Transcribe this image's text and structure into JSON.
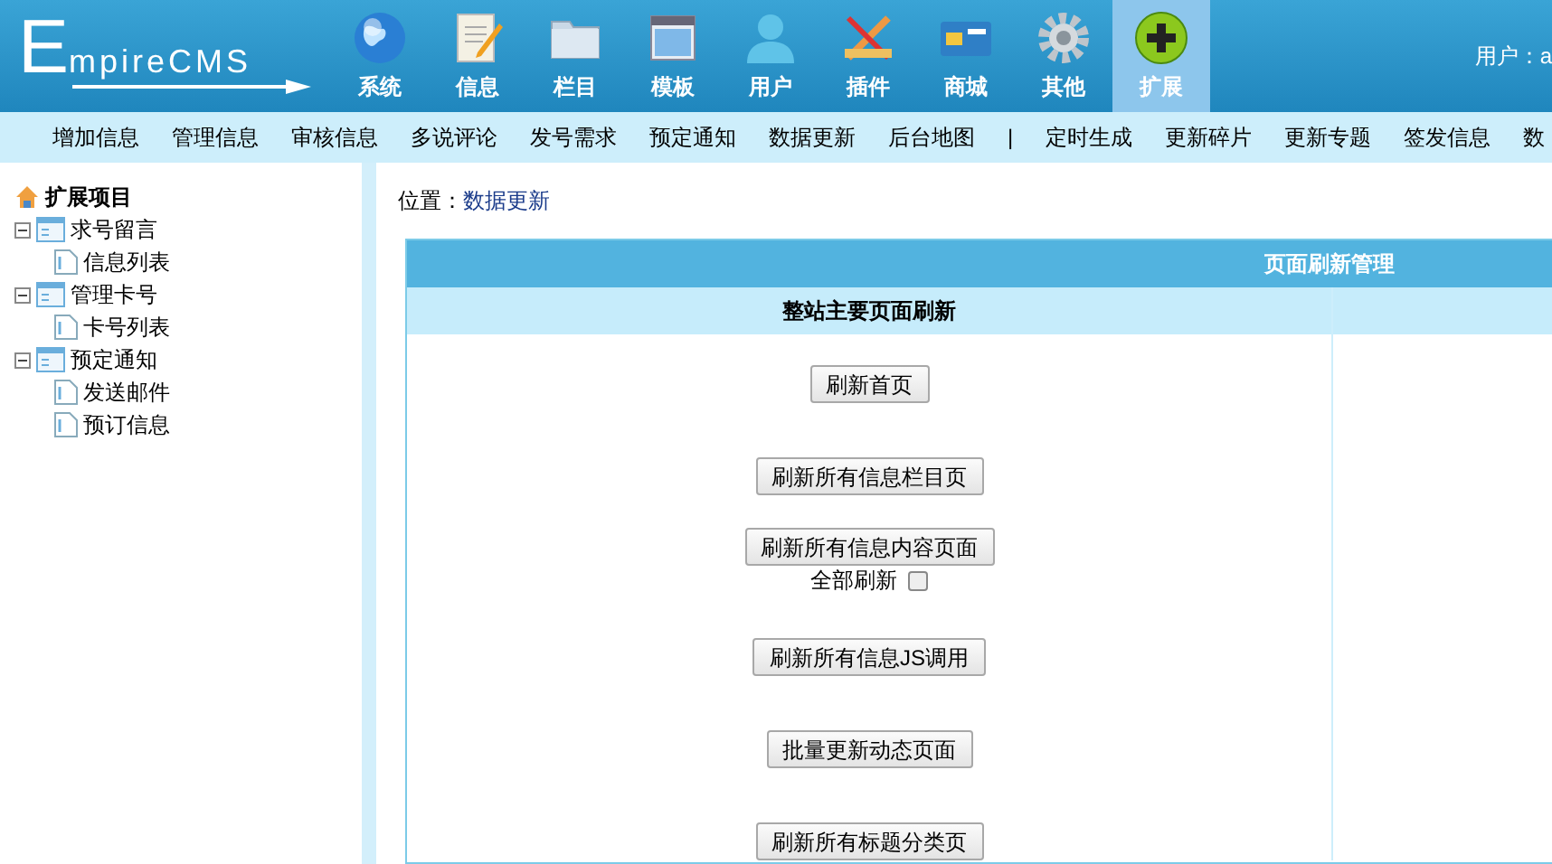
{
  "logo": "EmpireCMS",
  "nav": [
    {
      "label": "系统",
      "kind": "globe",
      "selected": false
    },
    {
      "label": "信息",
      "kind": "notepad",
      "selected": false
    },
    {
      "label": "栏目",
      "kind": "folder",
      "selected": false
    },
    {
      "label": "模板",
      "kind": "window",
      "selected": false
    },
    {
      "label": "用户",
      "kind": "user",
      "selected": false
    },
    {
      "label": "插件",
      "kind": "tools",
      "selected": false
    },
    {
      "label": "商城",
      "kind": "card",
      "selected": false
    },
    {
      "label": "其他",
      "kind": "gear",
      "selected": false
    },
    {
      "label": "扩展",
      "kind": "plus",
      "selected": true
    }
  ],
  "user_label": "用户：a",
  "subnav": [
    "增加信息",
    "管理信息",
    "审核信息",
    "多说评论",
    "发号需求",
    "预定通知",
    "数据更新",
    "后台地图",
    "|",
    "定时生成",
    "更新碎片",
    "更新专题",
    "签发信息",
    "数"
  ],
  "tree": {
    "title": "扩展项目",
    "children": [
      {
        "label": "求号留言",
        "children": [
          {
            "label": "信息列表"
          }
        ]
      },
      {
        "label": "管理卡号",
        "children": [
          {
            "label": "卡号列表"
          }
        ]
      },
      {
        "label": "预定通知",
        "children": [
          {
            "label": "发送邮件"
          },
          {
            "label": "预订信息"
          }
        ]
      }
    ]
  },
  "location": {
    "label": "位置：",
    "link": "数据更新"
  },
  "panel": {
    "title": "页面刷新管理",
    "section": "整站主要页面刷新",
    "rows": [
      {
        "kind": "button",
        "label": "刷新首页"
      },
      {
        "kind": "button",
        "label": "刷新所有信息栏目页"
      },
      {
        "kind": "button",
        "label": "刷新所有信息内容页面"
      },
      {
        "kind": "checkbox",
        "label": "全部刷新",
        "checked": false
      },
      {
        "kind": "button",
        "label": "刷新所有信息JS调用"
      },
      {
        "kind": "button",
        "label": "批量更新动态页面"
      },
      {
        "kind": "button",
        "label": "刷新所有标题分类页"
      }
    ]
  }
}
